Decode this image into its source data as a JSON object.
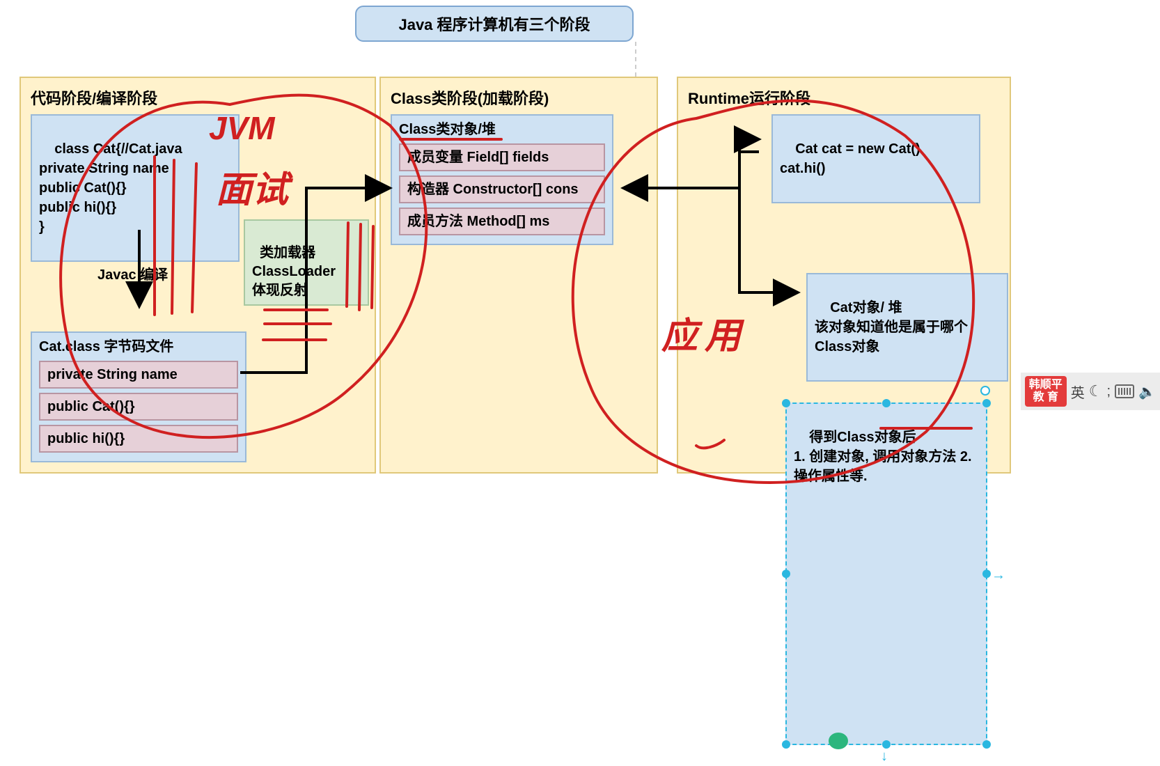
{
  "title": "Java 程序计算机有三个阶段",
  "stage1": {
    "title": "代码阶段/编译阶段",
    "codeBox": "class Cat{//Cat.java\nprivate String name\npublic Cat(){}\npublic hi(){}\n}",
    "compileLabel": "Javac 编译",
    "bytecodeTitle": "Cat.class 字节码文件",
    "bytecodeItems": [
      "private String name",
      "public Cat(){}",
      "public hi(){}"
    ],
    "classLoaderBox": "类加载器\nClassLoader\n体现反射"
  },
  "stage2": {
    "title": "Class类阶段(加载阶段)",
    "heapTitle": "Class类对象/堆",
    "items": [
      "成员变量 Field[] fields",
      "构造器 Constructor[] cons",
      "成员方法 Method[] ms"
    ]
  },
  "stage3": {
    "title": "Runtime运行阶段",
    "codeBox": "Cat cat = new Cat()\ncat.hi()",
    "heapBox": "Cat对象/ 堆\n该对象知道他是属于哪个Class对象",
    "reflectionBox": "得到Class对象后\n1. 创建对象, 调用对象方法 2. 操作属性等."
  },
  "annotations": {
    "jvm": "JVM",
    "interview": "面试",
    "application": "应用"
  },
  "ime": {
    "badge": "韩顺平\n教 育",
    "lang": "英",
    "sep": ";"
  }
}
